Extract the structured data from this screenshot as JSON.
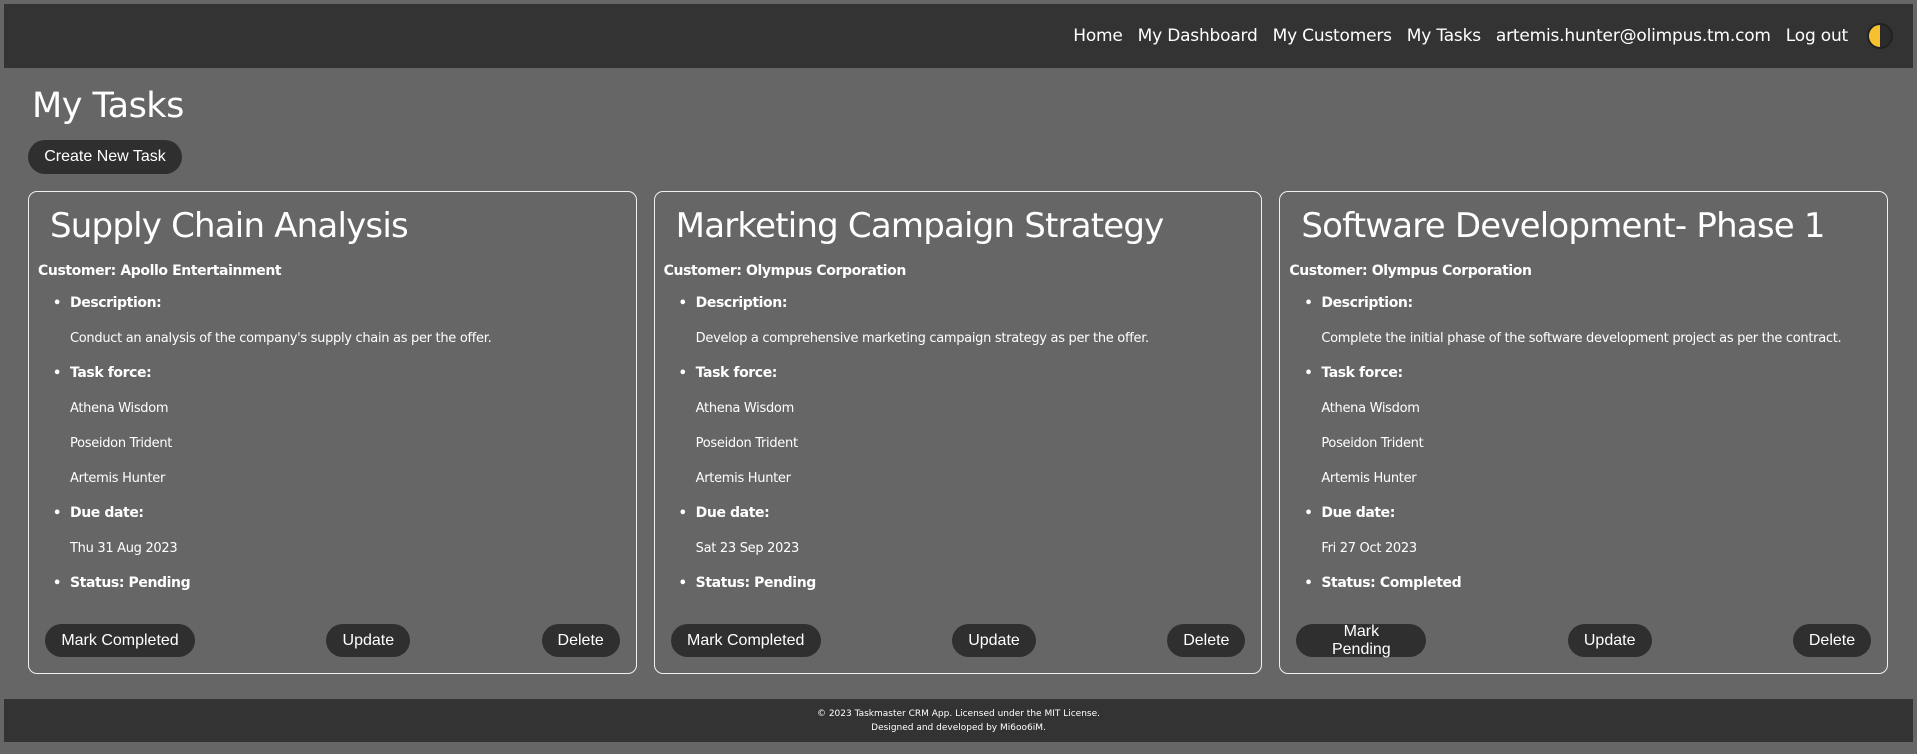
{
  "nav": {
    "links": [
      "Home",
      "My Dashboard",
      "My Customers",
      "My Tasks",
      "artemis.hunter@olimpus.tm.com",
      "Log out"
    ],
    "theme_toggle_icon": "half-moon-icon"
  },
  "page": {
    "title": "My Tasks",
    "create_button": "Create New Task"
  },
  "labels": {
    "description": "Description:",
    "task_force": "Task force:",
    "due_date": "Due date:",
    "update": "Update",
    "delete": "Delete"
  },
  "tasks": [
    {
      "title": "Supply Chain Analysis",
      "customer": "Customer: Apollo Entertainment",
      "description": "Conduct an analysis of the company's supply chain as per the offer.",
      "task_force": [
        "Athena Wisdom",
        "Poseidon Trident",
        "Artemis Hunter"
      ],
      "due_date": "Thu 31 Aug 2023",
      "status": "Status: Pending",
      "toggle_button": "Mark Completed"
    },
    {
      "title": "Marketing Campaign Strategy",
      "customer": "Customer: Olympus Corporation",
      "description": "Develop a comprehensive marketing campaign strategy as per the offer.",
      "task_force": [
        "Athena Wisdom",
        "Poseidon Trident",
        "Artemis Hunter"
      ],
      "due_date": "Sat 23 Sep 2023",
      "status": "Status: Pending",
      "toggle_button": "Mark Completed"
    },
    {
      "title": "Software Development- Phase 1",
      "customer": "Customer: Olympus Corporation",
      "description": "Complete the initial phase of the software development project as per the contract.",
      "task_force": [
        "Athena Wisdom",
        "Poseidon Trident",
        "Artemis Hunter"
      ],
      "due_date": "Fri 27 Oct 2023",
      "status": "Status: Completed",
      "toggle_button": "Mark Pending"
    }
  ],
  "footer": {
    "line1": "© 2023 Taskmaster CRM App. Licensed under the MIT License.",
    "line2": "Designed and developed by Mi6oo6iM."
  },
  "colors": {
    "background": "#666666",
    "navbar": "#333333",
    "button": "#2f2f2f",
    "text": "#ffffff"
  }
}
